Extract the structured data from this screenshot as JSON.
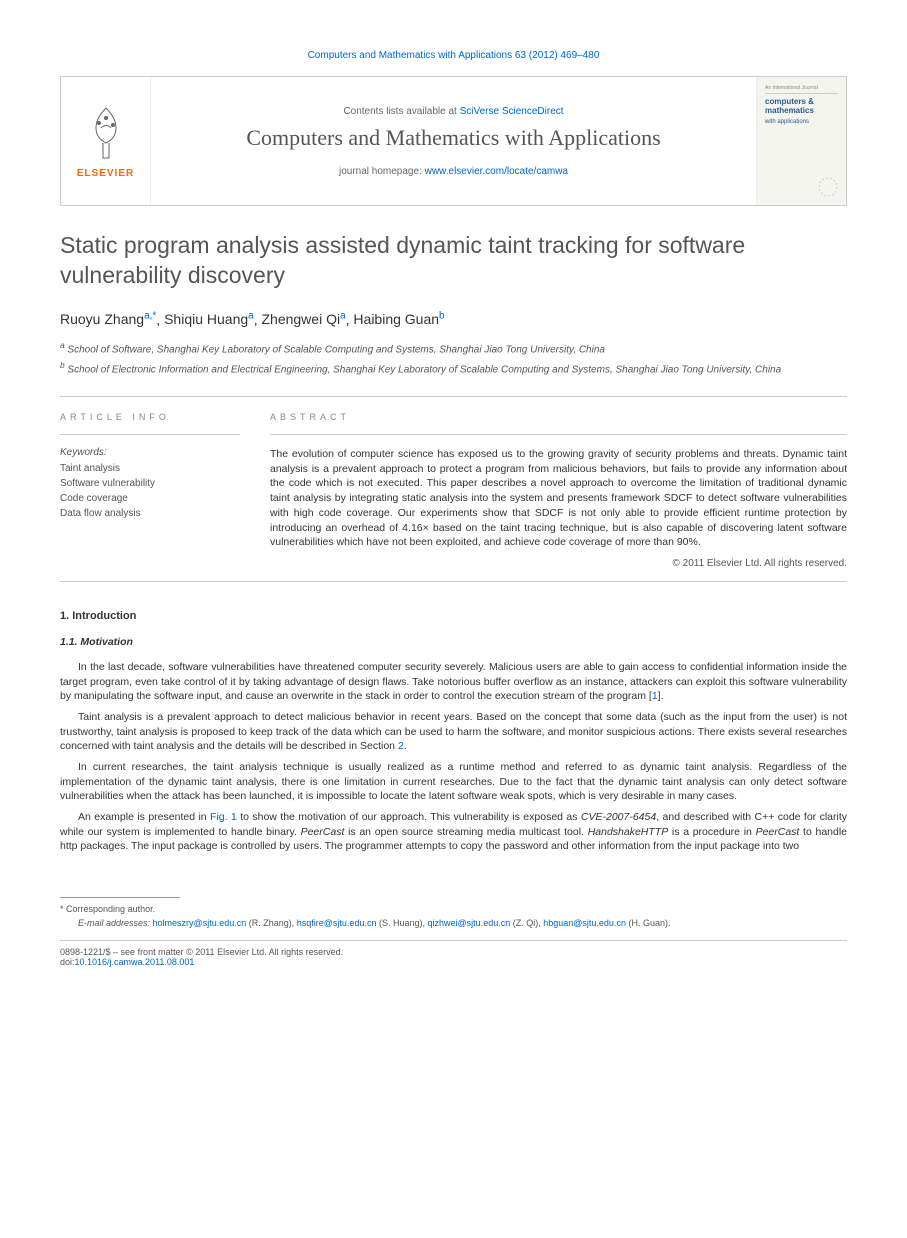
{
  "header": {
    "citation": "Computers and Mathematics with Applications 63 (2012) 469–480",
    "contents_prefix": "Contents lists available at ",
    "contents_link": "SciVerse ScienceDirect",
    "journal_name": "Computers and Mathematics with Applications",
    "homepage_prefix": "journal homepage: ",
    "homepage_link": "www.elsevier.com/locate/camwa",
    "elsevier_label": "ELSEVIER",
    "cover_title": "computers & mathematics",
    "cover_sub": "with applications"
  },
  "title": "Static program analysis assisted dynamic taint tracking for software vulnerability discovery",
  "authors": [
    {
      "name": "Ruoyu Zhang",
      "marks": "a,*"
    },
    {
      "name": "Shiqiu Huang",
      "marks": "a"
    },
    {
      "name": "Zhengwei Qi",
      "marks": "a"
    },
    {
      "name": "Haibing Guan",
      "marks": "b"
    }
  ],
  "affiliations": {
    "a": "School of Software, Shanghai Key Laboratory of Scalable Computing and Systems, Shanghai Jiao Tong University, China",
    "b": "School of Electronic Information and Electrical Engineering, Shanghai Key Laboratory of Scalable Computing and Systems, Shanghai Jiao Tong University, China"
  },
  "article_info": {
    "header": "ARTICLE INFO",
    "keywords_label": "Keywords:",
    "keywords": [
      "Taint analysis",
      "Software vulnerability",
      "Code coverage",
      "Data flow analysis"
    ]
  },
  "abstract": {
    "header": "ABSTRACT",
    "text": "The evolution of computer science has exposed us to the growing gravity of security problems and threats. Dynamic taint analysis is a prevalent approach to protect a program from malicious behaviors, but fails to provide any information about the code which is not executed. This paper describes a novel approach to overcome the limitation of traditional dynamic taint analysis by integrating static analysis into the system and presents framework SDCF to detect software vulnerabilities with high code coverage. Our experiments show that SDCF is not only able to provide efficient runtime protection by introducing an overhead of 4.16× based on the taint tracing technique, but is also capable of discovering latent software vulnerabilities which have not been exploited, and achieve code coverage of more than 90%.",
    "copyright": "© 2011 Elsevier Ltd. All rights reserved."
  },
  "sections": {
    "intro_num": "1. Introduction",
    "motivation_num": "1.1. Motivation",
    "para1": "In the last decade, software vulnerabilities have threatened computer security severely. Malicious users are able to gain access to confidential information inside the target program, even take control of it by taking advantage of design flaws. Take notorious buffer overflow as an instance, attackers can exploit this software vulnerability by manipulating the software input, and cause an overwrite in the stack in order to control the execution stream of the program [",
    "para1_ref": "1",
    "para1_end": "].",
    "para2": "Taint analysis is a prevalent approach to detect malicious behavior in recent years. Based on the concept that some data (such as the input from the user) is not trustworthy, taint analysis is proposed to keep track of the data which can be used to harm the software, and monitor suspicious actions. There exists several researches concerned with taint analysis and the details will be described in Section ",
    "para2_ref": "2",
    "para2_end": ".",
    "para3": "In current researches, the taint analysis technique is usually realized as a runtime method and referred to as dynamic taint analysis. Regardless of the implementation of the dynamic taint analysis, there is one limitation in current researches. Due to the fact that the dynamic taint analysis can only detect software vulnerabilities when the attack has been launched, it is impossible to locate the latent software weak spots, which is very desirable in many cases.",
    "para4_start": "An example is presented in ",
    "para4_fig": "Fig. 1",
    "para4_mid": " to show the motivation of our approach. This vulnerability is exposed as ",
    "para4_cve": "CVE-2007-6454",
    "para4_mid2": ", and described with C++ code for clarity while our system is implemented to handle binary. ",
    "para4_peercast": "PeerCast",
    "para4_mid3": " is an open source streaming media multicast tool. ",
    "para4_handshake": "HandshakeHTTP",
    "para4_mid4": " is a procedure in ",
    "para4_peercast2": "PeerCast",
    "para4_end": " to handle http packages. The input package is controlled by users. The programmer attempts to copy the password and other information from the input package into two"
  },
  "footer": {
    "corr_marker": "*",
    "corr_text": "Corresponding author.",
    "email_label": "E-mail addresses:",
    "emails": [
      {
        "email": "holmeszry@sjtu.edu.cn",
        "name": "(R. Zhang)"
      },
      {
        "email": "hsqfire@sjtu.edu.cn",
        "name": "(S. Huang)"
      },
      {
        "email": "qizhwei@sjtu.edu.cn",
        "name": "(Z. Qi)"
      },
      {
        "email": "hbguan@sjtu.edu.cn",
        "name": "(H. Guan)"
      }
    ],
    "coden": "0898-1221/$ – see front matter © 2011 Elsevier Ltd. All rights reserved.",
    "doi_label": "doi:",
    "doi": "10.1016/j.camwa.2011.08.001"
  }
}
